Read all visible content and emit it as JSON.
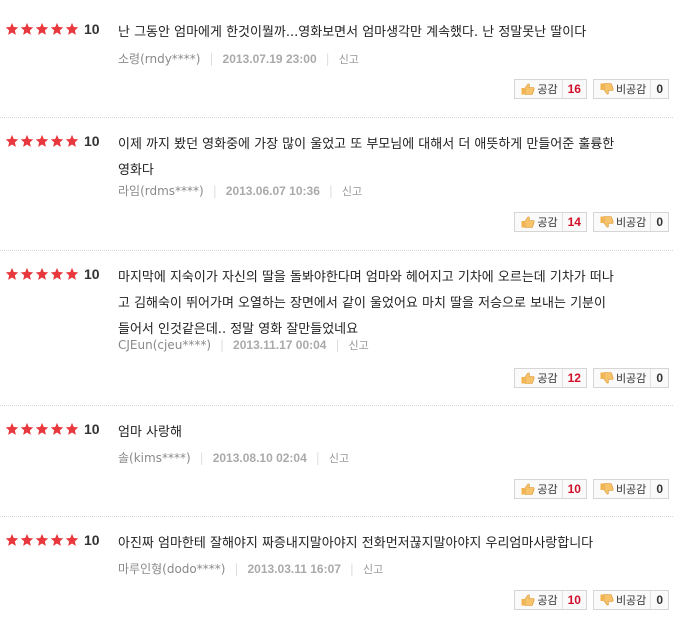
{
  "labels": {
    "like": "공감",
    "dislike": "비공감",
    "report": "신고"
  },
  "colors": {
    "star": "#e8383d",
    "like_count": "#d0102b"
  },
  "reviews": [
    {
      "rating": "10",
      "text": "난 그동안 엄마에게 한것이뭘까...영화보면서 엄마생각만 계속했다. 난 정말못난 딸이다",
      "user": "소령(rndy****)",
      "date": "2013.07.19 23:00",
      "likes": "16",
      "dislikes": "0"
    },
    {
      "rating": "10",
      "text": "이제 까지 봤던 영화중에 가장 많이 울었고 또 부모님에 대해서 더 애뜻하게 만들어준 훌륭한\n영화다",
      "user": "라임(rdms****)",
      "date": "2013.06.07 10:36",
      "likes": "14",
      "dislikes": "0"
    },
    {
      "rating": "10",
      "text": "마지막에 지숙이가 자신의 딸을 돌봐야한다며 엄마와 헤어지고 기차에 오르는데 기차가 떠나\n고 김해숙이 뛰어가며 오열하는 장면에서 같이 울었어요 마치 딸을 저승으로 보내는 기분이\n들어서 인것같은데.. 정말 영화 잘만들었네요",
      "user": "CJEun(cjeu****)",
      "date": "2013.11.17 00:04",
      "likes": "12",
      "dislikes": "0"
    },
    {
      "rating": "10",
      "text": "엄마 사랑해",
      "user": "솔(kims****)",
      "date": "2013.08.10 02:04",
      "likes": "10",
      "dislikes": "0"
    },
    {
      "rating": "10",
      "text": "아진짜 엄마한테 잘해야지 짜증내지말아야지 전화먼저끊지말아야지 우리엄마사랑합니다",
      "user": "마루인형(dodo****)",
      "date": "2013.03.11 16:07",
      "likes": "10",
      "dislikes": "0"
    }
  ]
}
